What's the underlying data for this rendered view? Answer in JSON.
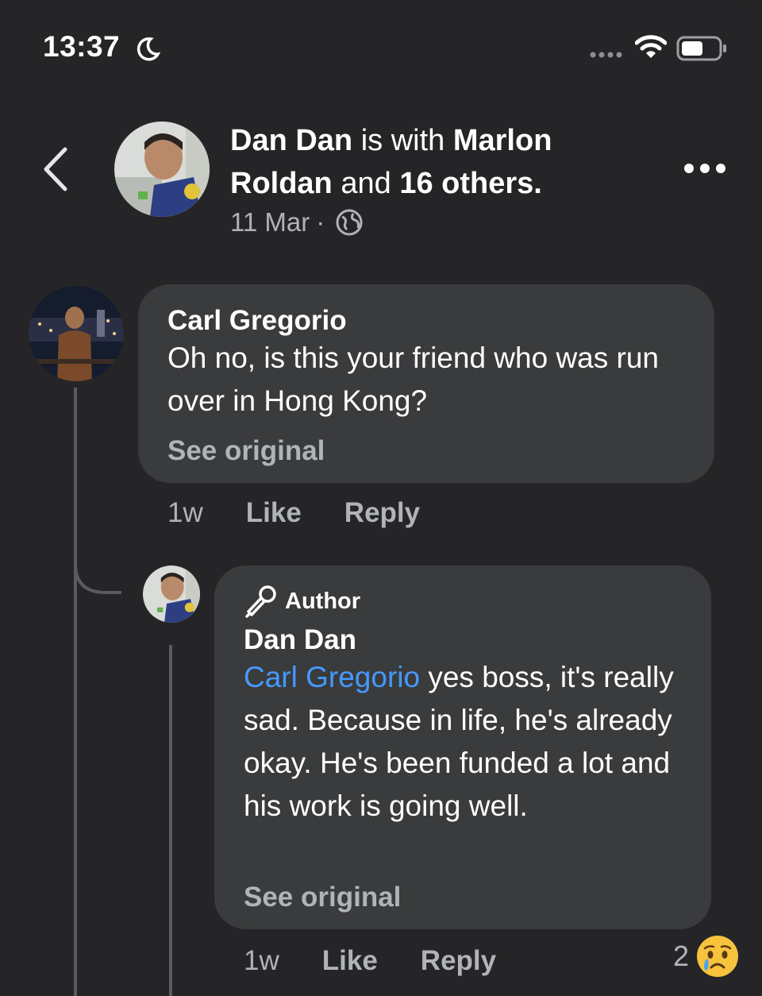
{
  "status_bar": {
    "time": "13:37",
    "icons": [
      "moon-icon",
      "signal-dots-icon",
      "wifi-icon",
      "battery-icon"
    ]
  },
  "post_header": {
    "author": "Dan Dan",
    "with_text": "is with",
    "tagged": "Marlon Roldan",
    "and_text": "and",
    "others": "16 others",
    "period": ".",
    "date": "11 Mar",
    "separator": "·",
    "privacy_icon": "globe-icon"
  },
  "comments": [
    {
      "author": "Carl Gregorio",
      "text": "Oh no, is this your friend who was run over in Hong Kong?",
      "see_original": "See original",
      "time": "1w",
      "like_label": "Like",
      "reply_label": "Reply"
    },
    {
      "badge": "Author",
      "author": "Dan Dan",
      "mention": "Carl Gregorio",
      "text": " yes boss, it's really sad. Because in life, he's already okay. He's been funded a lot and his work is going well.",
      "see_original": "See original",
      "time": "1w",
      "like_label": "Like",
      "reply_label": "Reply",
      "reaction_count": "2",
      "reaction_icon": "sad-face-icon"
    }
  ],
  "colors": {
    "background": "#252527",
    "bubble": "#3a3b3c",
    "mention": "#4599ff",
    "secondary_text": "#b0b3b8"
  }
}
